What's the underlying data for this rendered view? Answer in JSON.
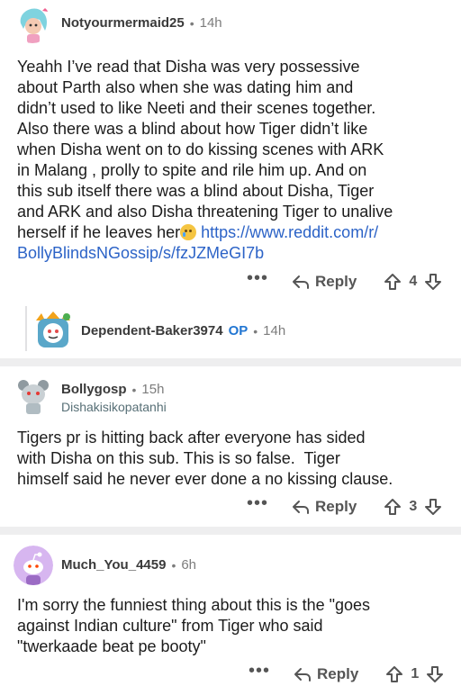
{
  "comments": [
    {
      "username": "Notyourmermaid25",
      "separator": "•",
      "time": "14h",
      "body_1": "Yeahh I’ve read that Disha was very possessive\nabout Parth also when she was dating him and\ndidn’t used to like Neeti and their scenes together.\nAlso there was a blind about how Tiger didn’t like\nwhen Disha went on to do kissing scenes with ARK\nin Malang , prolly to spite and rile him up. And on\nthis sub itself there was a blind about Disha, Tiger\nand ARK and also Disha threatening Tiger to unalive\nherself if he leaves her",
      "emoji": "crying-face-emoji",
      "link": "https://www.reddit.com/r/\nBollyBlindsNGossip/s/fzJZMeGI7b",
      "dots": "•••",
      "reply_label": "Reply",
      "score": "4"
    },
    {
      "username": "Dependent-Baker3974",
      "op_badge": "OP",
      "separator": "•",
      "time": "14h"
    },
    {
      "username": "Bollygosp",
      "separator": "•",
      "time": "15h",
      "flair": "Dishakisikopatanhi",
      "body": "Tigers pr is hitting back after everyone has sided\nwith Disha on this sub. This is so false.  Tiger\nhimself said he never ever done a no kissing clause.",
      "dots": "•••",
      "reply_label": "Reply",
      "score": "3"
    },
    {
      "username": "Much_You_4459",
      "separator": "•",
      "time": "6h",
      "body": "I'm sorry the funniest thing about this is the \"goes\nagainst Indian culture\" from Tiger who said\n\"twerkaade beat pe booty\"",
      "dots": "•••",
      "reply_label": "Reply",
      "score": "1"
    }
  ],
  "icons": {
    "reply": "reply-arrow-icon",
    "upvote": "upvote-arrow-icon",
    "downvote": "downvote-arrow-icon",
    "more": "more-dots-icon"
  },
  "colors": {
    "link": "#2c63c7",
    "op": "#2276d2",
    "divider": "#eeeeef"
  }
}
